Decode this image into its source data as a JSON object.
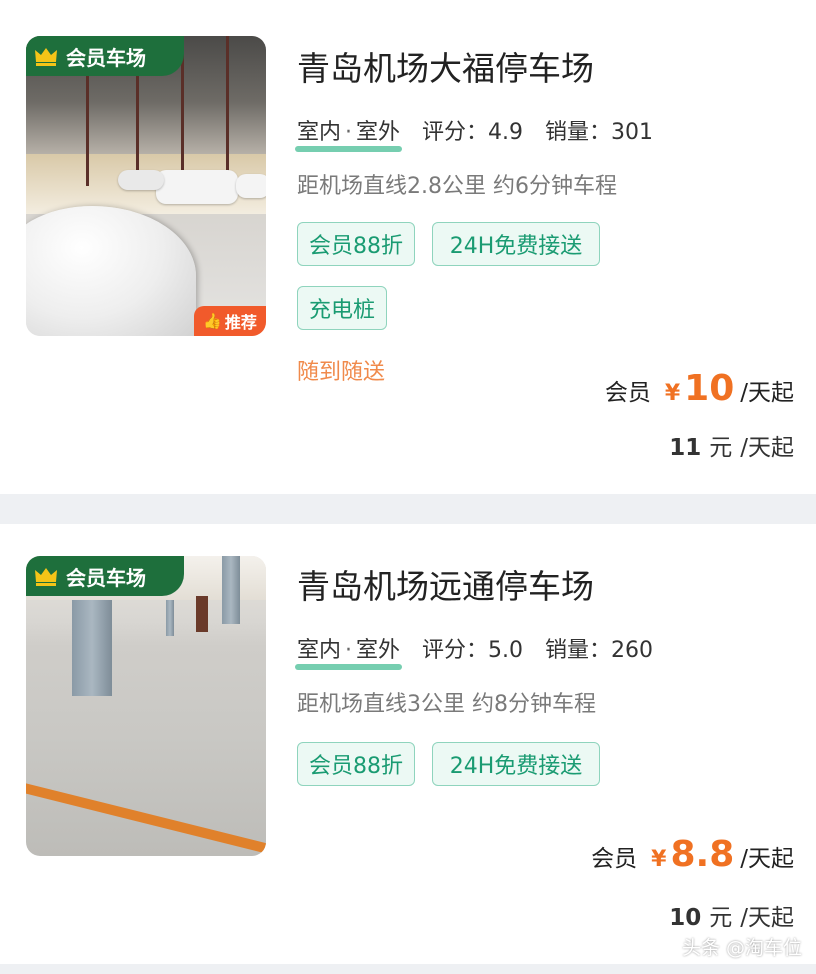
{
  "listings": [
    {
      "member_badge": "会员车场",
      "recommend_badge": "推荐",
      "title": "青岛机场大福停车场",
      "env_indoor": "室内",
      "env_sep": "·",
      "env_outdoor": "室外",
      "rating": "评分：4.9",
      "sales": "销量：301",
      "distance": "距机场直线2.8公里 约6分钟车程",
      "tags": [
        "会员88折",
        "24H免费接送",
        "充电桩"
      ],
      "note": "随到随送",
      "member_label": "会员",
      "currency": "¥",
      "member_price": "10",
      "price_unit": "/天起",
      "regular_price": "11",
      "regular_currency": "元",
      "regular_unit": "/天起"
    },
    {
      "member_badge": "会员车场",
      "title": "青岛机场远通停车场",
      "env_indoor": "室内",
      "env_sep": "·",
      "env_outdoor": "室外",
      "rating": "评分：5.0",
      "sales": "销量：260",
      "distance": "距机场直线3公里 约8分钟车程",
      "tags": [
        "会员88折",
        "24H免费接送"
      ],
      "member_label": "会员",
      "currency": "¥",
      "member_price": "8.8",
      "price_unit": "/天起",
      "regular_price": "10",
      "regular_currency": "元",
      "regular_unit": "/天起"
    }
  ],
  "watermark": "头条 @淘车位",
  "colors": {
    "brand_green": "#1e6f3c",
    "tag_green": "#1a9b72",
    "price_orange": "#f07122",
    "recommend_orange": "#f15a2b"
  },
  "icons": [
    "crown-icon",
    "thumbs-up-icon"
  ]
}
